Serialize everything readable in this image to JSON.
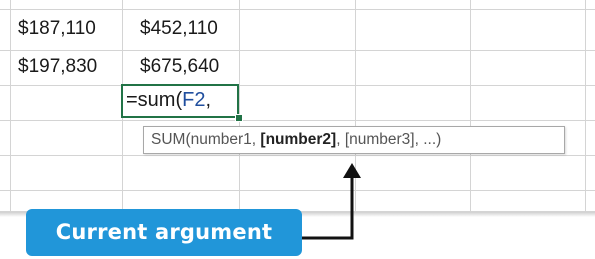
{
  "cells": {
    "row1": {
      "col_a": "$187,110",
      "col_b": "$452,110"
    },
    "row2": {
      "col_a": "$197,830",
      "col_b": "$675,640"
    }
  },
  "formula": {
    "prefix": "=sum(",
    "reference": "F2",
    "suffix": ","
  },
  "tooltip": {
    "before": "SUM(number1, ",
    "current_argument": "[number2]",
    "after": ", [number3], ...)"
  },
  "callout": {
    "label": "Current argument"
  },
  "colors": {
    "active_cell_border": "#217346",
    "cell_reference": "#1f4e9e",
    "callout_background": "#2196d9",
    "gridline": "#d4d4d4"
  }
}
